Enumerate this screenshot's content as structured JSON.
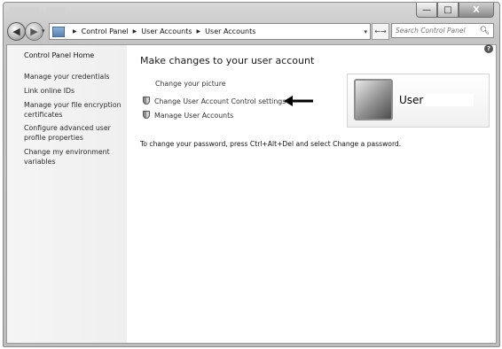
{
  "window": {
    "controls": {
      "minimize": "—",
      "maximize": "□",
      "close": "X"
    }
  },
  "nav": {
    "back": "◀",
    "forward": "▶",
    "dropdown": "▾",
    "breadcrumbs": [
      "Control Panel",
      "User Accounts",
      "User Accounts"
    ],
    "crumb_separator": "▶",
    "refresh": "←→",
    "search_placeholder": "Search Control Panel"
  },
  "sidebar": {
    "home": "Control Panel Home",
    "links": [
      "Manage your credentials",
      "Link online IDs",
      "Manage your file encryption certificates",
      "Configure advanced user profile properties",
      "Change my environment variables"
    ]
  },
  "main": {
    "heading": "Make changes to your user account",
    "tasks": [
      {
        "label": "Change your picture",
        "icon": "none"
      },
      {
        "label": "Change User Account Control settings",
        "icon": "shield-icon"
      },
      {
        "label": "Manage User Accounts",
        "icon": "shield-icon"
      }
    ],
    "info": "To change your password, press Ctrl+Alt+Del and select Change a password.",
    "help": "?"
  },
  "user": {
    "name": "User"
  }
}
